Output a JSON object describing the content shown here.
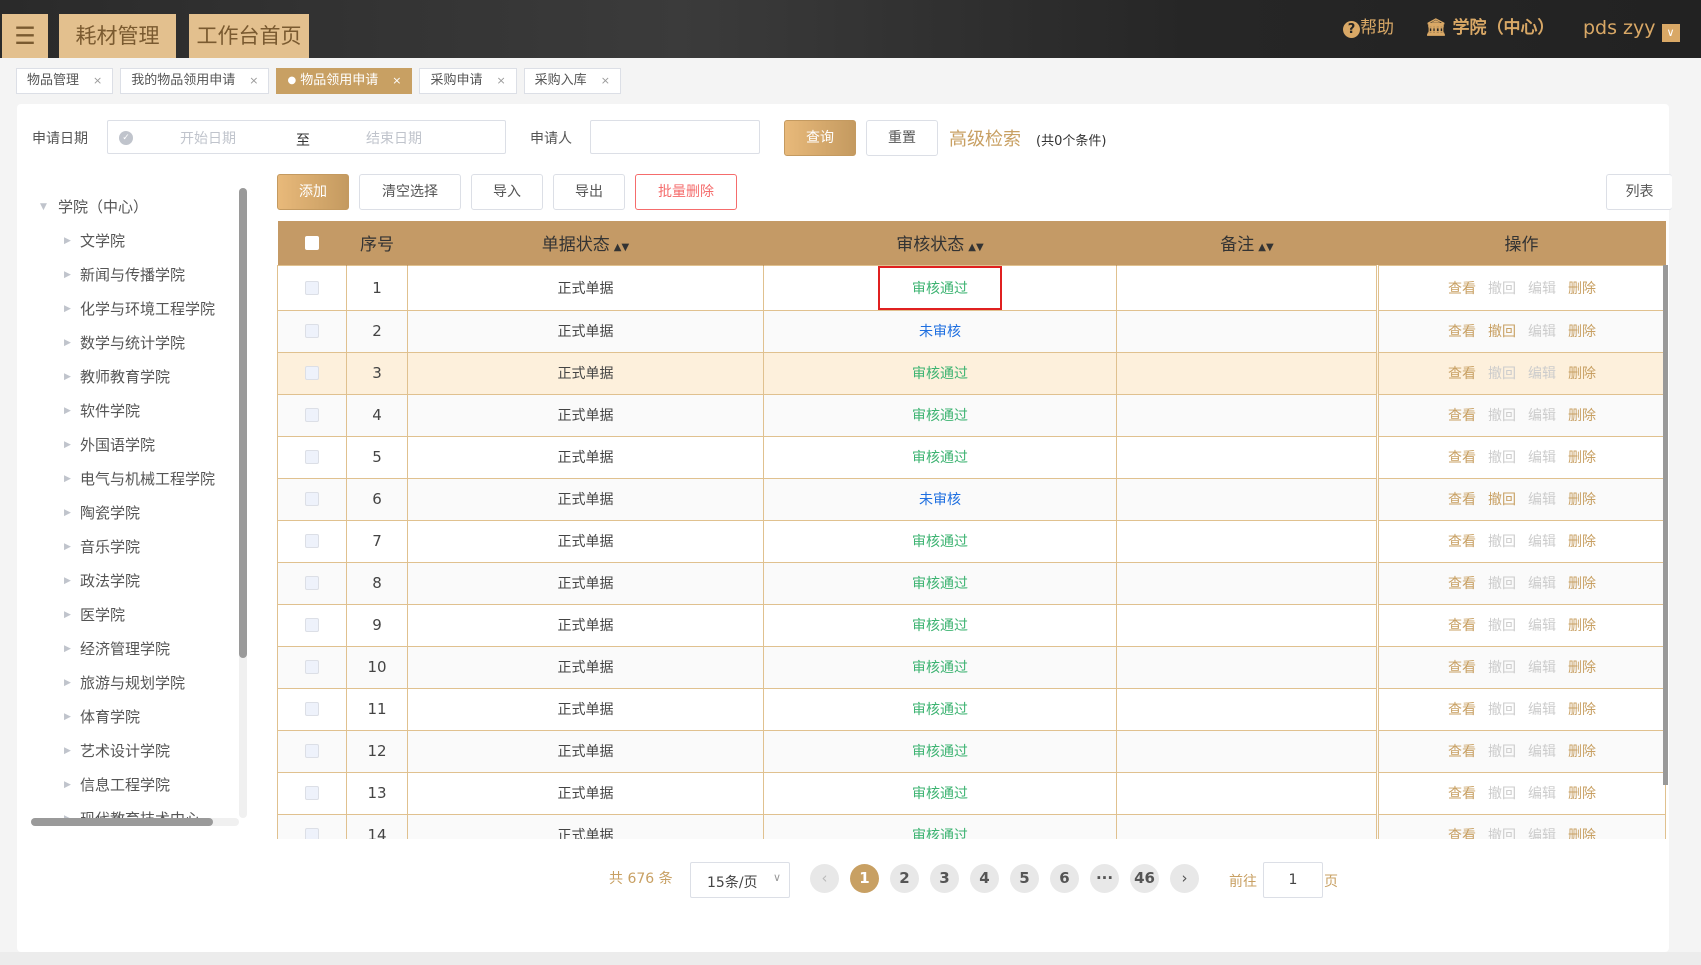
{
  "header": {
    "menu_icon": "hamburger-icon",
    "nav": [
      "耗材管理",
      "工作台首页"
    ],
    "help": "帮助",
    "org": "学院（中心）",
    "user": "pds zyy"
  },
  "tabs": [
    {
      "label": "物品管理",
      "active": false
    },
    {
      "label": "我的物品领用申请",
      "active": false
    },
    {
      "label": "物品领用申请",
      "active": true
    },
    {
      "label": "采购申请",
      "active": false
    },
    {
      "label": "采购入库",
      "active": false
    }
  ],
  "filter": {
    "date_label": "申请日期",
    "start_placeholder": "开始日期",
    "to": "至",
    "end_placeholder": "结束日期",
    "applicant_label": "申请人",
    "applicant_value": "",
    "search": "查询",
    "reset": "重置",
    "advanced": "高级检索",
    "condition_count": "(共0个条件)"
  },
  "toolbar": {
    "add": "添加",
    "clear": "清空选择",
    "import": "导入",
    "export": "导出",
    "batch_delete": "批量删除",
    "list": "列表"
  },
  "tree": {
    "root": "学院（中心）",
    "children": [
      "文学院",
      "新闻与传播学院",
      "化学与环境工程学院",
      "数学与统计学院",
      "教师教育学院",
      "软件学院",
      "外国语学院",
      "电气与机械工程学院",
      "陶瓷学院",
      "音乐学院",
      "政法学院",
      "医学院",
      "经济管理学院",
      "旅游与规划学院",
      "体育学院",
      "艺术设计学院",
      "信息工程学院",
      "现代教育技术中心"
    ]
  },
  "table": {
    "columns": [
      "序号",
      "单据状态",
      "审核状态",
      "备注",
      "操作"
    ],
    "actions": [
      "查看",
      "撤回",
      "编辑",
      "删除"
    ],
    "rows": [
      {
        "no": "1",
        "doc": "正式单据",
        "audit": "审核通过",
        "remark": ""
      },
      {
        "no": "2",
        "doc": "正式单据",
        "audit": "未审核",
        "remark": ""
      },
      {
        "no": "3",
        "doc": "正式单据",
        "audit": "审核通过",
        "remark": ""
      },
      {
        "no": "4",
        "doc": "正式单据",
        "audit": "审核通过",
        "remark": ""
      },
      {
        "no": "5",
        "doc": "正式单据",
        "audit": "审核通过",
        "remark": ""
      },
      {
        "no": "6",
        "doc": "正式单据",
        "audit": "未审核",
        "remark": ""
      },
      {
        "no": "7",
        "doc": "正式单据",
        "audit": "审核通过",
        "remark": ""
      },
      {
        "no": "8",
        "doc": "正式单据",
        "audit": "审核通过",
        "remark": ""
      },
      {
        "no": "9",
        "doc": "正式单据",
        "audit": "审核通过",
        "remark": ""
      },
      {
        "no": "10",
        "doc": "正式单据",
        "audit": "审核通过",
        "remark": ""
      },
      {
        "no": "11",
        "doc": "正式单据",
        "audit": "审核通过",
        "remark": ""
      },
      {
        "no": "12",
        "doc": "正式单据",
        "audit": "审核通过",
        "remark": ""
      },
      {
        "no": "13",
        "doc": "正式单据",
        "audit": "审核通过",
        "remark": ""
      },
      {
        "no": "14",
        "doc": "正式单据",
        "audit": "审核通过",
        "remark": ""
      }
    ]
  },
  "pagination": {
    "total": "共 676 条",
    "page_size": "15条/页",
    "pages": [
      "1",
      "2",
      "3",
      "4",
      "5",
      "6",
      "···",
      "46"
    ],
    "current": "1",
    "goto_label": "前往",
    "goto_value": "1",
    "page_unit": "页"
  },
  "colors": {
    "accent": "#c8a063",
    "approved": "#3cb371",
    "pending": "#1e6fe0",
    "danger": "#f56c6c"
  }
}
